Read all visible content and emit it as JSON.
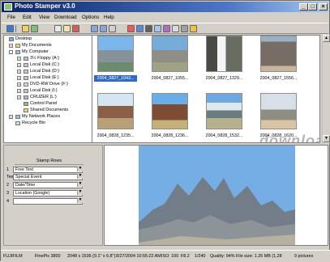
{
  "window": {
    "title": "Photo Stamper v3.0",
    "controls": [
      "_",
      "□",
      "×"
    ]
  },
  "menu": [
    "File",
    "Edit",
    "View",
    "Download",
    "Options",
    "Help"
  ],
  "toolbar": {
    "icon_names": [
      "save-icon",
      "toolbar-separator-icon",
      "open-icon",
      "refresh-icon",
      "copy-icon",
      "paste-icon",
      "cut-icon",
      "rotate-left-icon",
      "rotate-right-icon",
      "flip-icon",
      "stamp-icon",
      "filter-icon",
      "camera-icon",
      "zoom-icon",
      "download-icon",
      "print-icon",
      "settings-icon",
      "help-icon"
    ]
  },
  "folders": [
    {
      "label": "Desktop",
      "level": 0,
      "expander": ""
    },
    {
      "label": "My Documents",
      "level": 1,
      "expander": "+"
    },
    {
      "label": "My Computer",
      "level": 1,
      "expander": "-"
    },
    {
      "label": "3½ Floppy (A:)",
      "level": 2,
      "expander": "+"
    },
    {
      "label": "Local Disk (C:)",
      "level": 2,
      "expander": "+"
    },
    {
      "label": "Local Disk (D:)",
      "level": 2,
      "expander": "+"
    },
    {
      "label": "Local Disk (E:)",
      "level": 2,
      "expander": "+"
    },
    {
      "label": "DVD-RW Drive (F:)",
      "level": 2,
      "expander": "+"
    },
    {
      "label": "Local Disk (I:)",
      "level": 2,
      "expander": "+"
    },
    {
      "label": "CRUZER (L:)",
      "level": 2,
      "expander": "+"
    },
    {
      "label": "Control Panel",
      "level": 2,
      "expander": ""
    },
    {
      "label": "Shared Documents",
      "level": 2,
      "expander": ""
    },
    {
      "label": "My Network Places",
      "level": 1,
      "expander": "+"
    },
    {
      "label": "Recycle Bin",
      "level": 1,
      "expander": ""
    }
  ],
  "stamp_rows": {
    "header": "Stamp Rows",
    "rows": [
      {
        "num": "1",
        "value": "Free Text"
      },
      {
        "num": "Text",
        "value": "Special Event"
      },
      {
        "num": "2",
        "value": "Date/Time"
      },
      {
        "num": "3",
        "value": "Location (Google)"
      },
      {
        "num": "4",
        "value": ""
      }
    ]
  },
  "thumbnails": [
    {
      "label": "2004_0827_1043...",
      "selected": true
    },
    {
      "label": "2004_0827_1055...",
      "selected": false
    },
    {
      "label": "2004_0827_1329...",
      "selected": false
    },
    {
      "label": "2004_0827_1556...",
      "selected": false
    },
    {
      "label": "2004_0828_1235...",
      "selected": false
    },
    {
      "label": "2004_0828_1236...",
      "selected": false
    },
    {
      "label": "2004_0828_1532...",
      "selected": false
    },
    {
      "label": "2004_0828_1620...",
      "selected": false
    }
  ],
  "watermark": "download",
  "status": {
    "camera_make": "FUJIFILM",
    "camera_model": "FinePix 3800",
    "dimensions": "2048 x 1536 (9.1\" x 6.8\")",
    "datetime": "8/27/2004 10:55:22 AM",
    "iso": "ISO: 100",
    "aperture": "F8.2",
    "shutter": "1/240",
    "quality": "Quality: 94%",
    "file_size": "File size: 1.26 MB (1,28",
    "count": "9 pictures"
  },
  "colors": {
    "selection": "#316ac5",
    "titlebar": "#0a246a",
    "sky": "#74aee4",
    "rock": "#737d89"
  }
}
